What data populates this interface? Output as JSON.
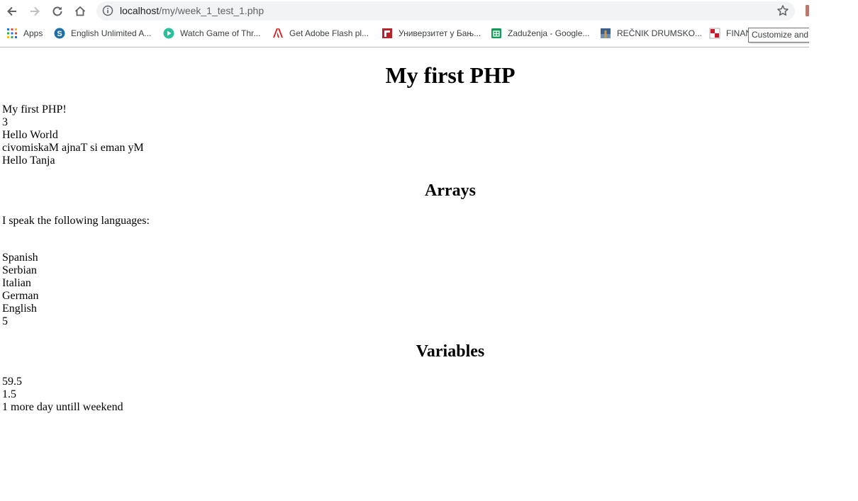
{
  "browser": {
    "url_host": "localhost",
    "url_path": "/my/week_1_test_1.php",
    "tooltip": "Customize and control Google Chrome",
    "bookmarks": [
      {
        "label": "Apps",
        "icon": "apps-grid-icon"
      },
      {
        "label": "English Unlimited A...",
        "icon": "english-unlimited-icon"
      },
      {
        "label": "Watch Game of Thr...",
        "icon": "play-circle-icon"
      },
      {
        "label": "Get Adobe Flash pl...",
        "icon": "adobe-icon"
      },
      {
        "label": "Универзитет у Бањ...",
        "icon": "university-icon"
      },
      {
        "label": "Zaduženja - Google...",
        "icon": "google-sheets-icon"
      },
      {
        "label": "REČNIK DRUMSKO...",
        "icon": "recnik-icon"
      },
      {
        "label": "FINAN",
        "icon": "finance-icon"
      }
    ]
  },
  "page": {
    "title": "My first PHP",
    "intro_lines": [
      "My first PHP!",
      "3",
      "Hello World",
      "civomiskaM ajnaT si eman yM",
      "Hello Tanja"
    ],
    "arrays_heading": "Arrays",
    "languages_intro": "I speak the following languages:",
    "languages": [
      "Spanish",
      "Serbian",
      "Italian",
      "German",
      "English"
    ],
    "languages_count": "5",
    "variables_heading": "Variables",
    "variables_lines": [
      "59.5",
      "1.5",
      "1 more day untill weekend"
    ]
  }
}
